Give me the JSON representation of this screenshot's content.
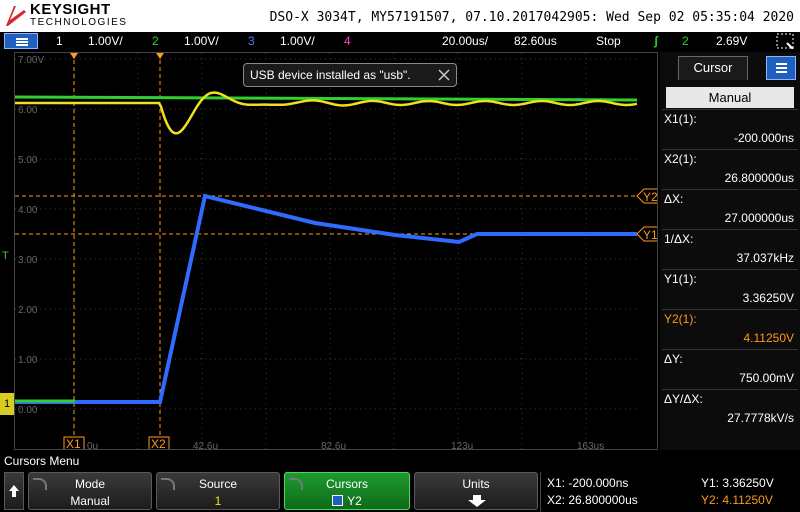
{
  "brand": {
    "name": "KEYSIGHT",
    "sub": "TECHNOLOGIES"
  },
  "device_info": "DSO-X 3034T, MY57191507, 07.10.2017042905: Wed Sep 02 05:35:04 2020",
  "channels": [
    {
      "num": "1",
      "scale": "1.00V/",
      "color": "#f0e020"
    },
    {
      "num": "2",
      "scale": "1.00V/",
      "color": "#30d030"
    },
    {
      "num": "3",
      "scale": "1.00V/",
      "color": "#4b7bff"
    },
    {
      "num": "4",
      "scale": "",
      "color": "#ff40c0"
    }
  ],
  "timebase": {
    "scale": "20.00us/",
    "delay": "82.60us"
  },
  "run_status": "Stop",
  "trigger": {
    "source": "2",
    "level": "2.69V"
  },
  "notification": "USB device installed as \"usb\".",
  "grid": {
    "ylabels": [
      "7.00V",
      "6.00",
      "5.00",
      "4.00",
      "3.00",
      "2.00",
      "1.00",
      "0.00"
    ],
    "xlabels": [
      "0u",
      "42.6u",
      "82.6u",
      "123u",
      "163us"
    ],
    "marker_labels": {
      "x1": "X1",
      "x2": "X2",
      "y1": "Y1",
      "y2": "Y2",
      "ground": "1",
      "trigger": "T"
    }
  },
  "cursor_panel": {
    "title": "Cursor",
    "mode": "Manual",
    "rows": [
      {
        "label": "X1(1):",
        "value": "-200.000ns",
        "color": "#ffffff"
      },
      {
        "label": "X2(1):",
        "value": "26.800000us",
        "color": "#ffffff"
      },
      {
        "label": "ΔX:",
        "value": "27.000000us",
        "color": "#ffffff"
      },
      {
        "label": "1/ΔX:",
        "value": "37.037kHz",
        "color": "#ffffff"
      },
      {
        "label": "Y1(1):",
        "value": "3.36250V",
        "color": "#ffffff"
      },
      {
        "label": "Y2(1):",
        "value": "4.11250V",
        "color": "#ff9a1a"
      },
      {
        "label": "ΔY:",
        "value": "750.00mV",
        "color": "#ffffff"
      },
      {
        "label": "ΔY/ΔX:",
        "value": "27.7778kV/s",
        "color": "#ffffff"
      }
    ]
  },
  "menu_title": "Cursors Menu",
  "softkeys": [
    {
      "label": "Mode",
      "value": "Manual"
    },
    {
      "label": "Source",
      "value": "1"
    },
    {
      "label": "Cursors",
      "value": "Y2"
    },
    {
      "label": "Units",
      "value": ""
    }
  ],
  "readouts": {
    "x1": "X1: -200.000ns",
    "x2": "X2: 26.800000us",
    "y1": "Y1: 3.36250V",
    "y2": "Y2: 4.11250V"
  },
  "colors": {
    "ch1": "#f0e020",
    "ch2": "#30d030",
    "ch3": "#2f6bff",
    "cursor": "#ff9a1a"
  }
}
